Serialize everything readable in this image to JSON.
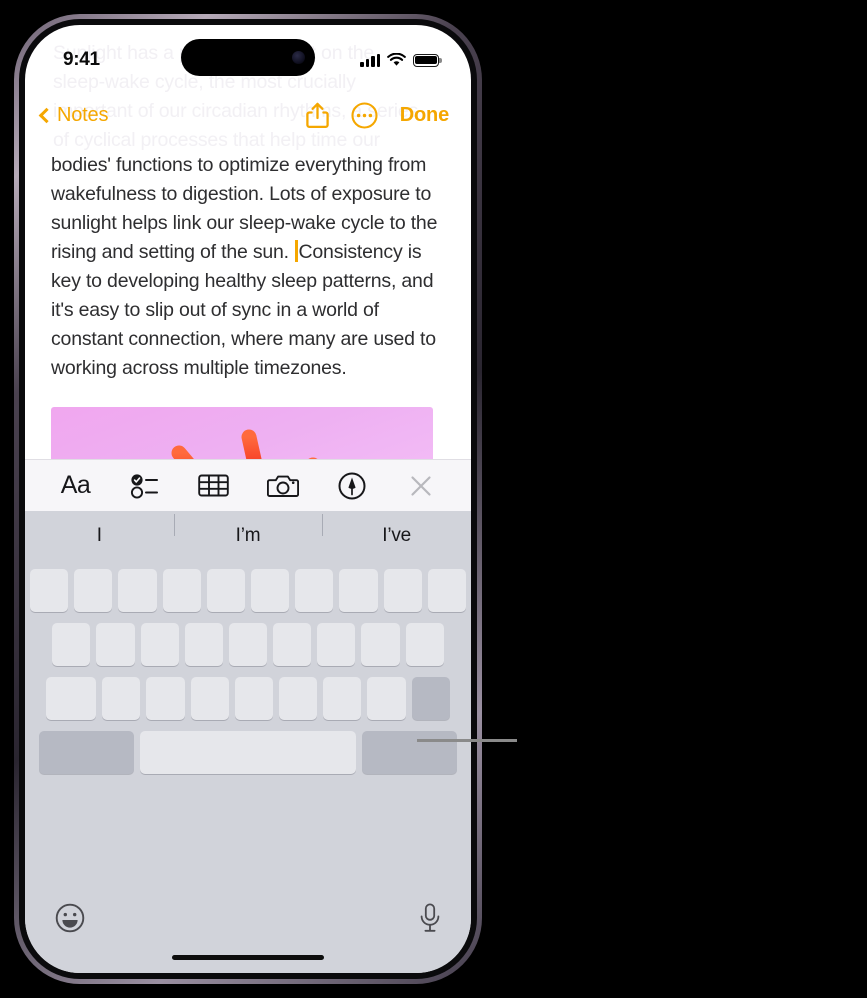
{
  "device": {
    "name": "iphone-15-pro",
    "buttons": [
      "action-button",
      "volume-up-button",
      "volume-down-button",
      "power-button"
    ]
  },
  "status_bar": {
    "time": "9:41",
    "signal_icon": "cellular-signal-icon",
    "wifi_icon": "wifi-icon",
    "battery_icon": "battery-full-icon"
  },
  "nav_bar": {
    "back_label": "Notes",
    "back_icon": "chevron-left-icon",
    "share_icon": "share-icon",
    "more_icon": "ellipsis-circle-icon",
    "done_label": "Done",
    "accent_color": "#F5A700"
  },
  "note": {
    "ghost_text": "Sunlight has a profound impact on the\nsleep-wake cycle, the most crucially\nimportant of our circadian rhythms, a series\nof cyclical processes that help time our",
    "body_before_caret": "bodies' functions to optimize everything from wakefulness to digestion. Lots of exposure to sunlight helps link our sleep-wake cycle to the rising and setting of the sun. ",
    "body_after_caret": "Consistency is key to developing healthy sleep patterns, and it's easy to slip out of sync in a world of constant connection, where many are used to working across multiple timezones.",
    "caret_color": "#F5A700",
    "attachment": {
      "name": "molecule-image",
      "background_start": "#f0a7ef",
      "background_end": "#f6c9f8"
    }
  },
  "format_toolbar": {
    "items": [
      {
        "label": "Aa",
        "icon": "text-format-icon"
      },
      {
        "label": "",
        "icon": "checklist-icon"
      },
      {
        "label": "",
        "icon": "table-icon"
      },
      {
        "label": "",
        "icon": "camera-icon"
      },
      {
        "label": "",
        "icon": "markup-pen-icon"
      },
      {
        "label": "",
        "icon": "close-icon"
      }
    ]
  },
  "keyboard": {
    "predictions": [
      "I",
      "I’m",
      "I’ve"
    ],
    "row1_keys": 10,
    "row2_keys": 9,
    "row3_keys": 9,
    "emoji_icon": "emoji-smiley-icon",
    "dictation_icon": "microphone-icon",
    "shift_key": "shift-key",
    "delete_key": "delete-key",
    "numbers_key": "numbers-key",
    "space_key": "space-key",
    "return_key": "return-key",
    "key_color": "#e6e7eb",
    "modifier_key_color": "#b6b9c3",
    "background_color": "#d1d3da"
  },
  "callout": {
    "name": "keyboard-key-callout-line",
    "color": "#8a8a8a"
  }
}
